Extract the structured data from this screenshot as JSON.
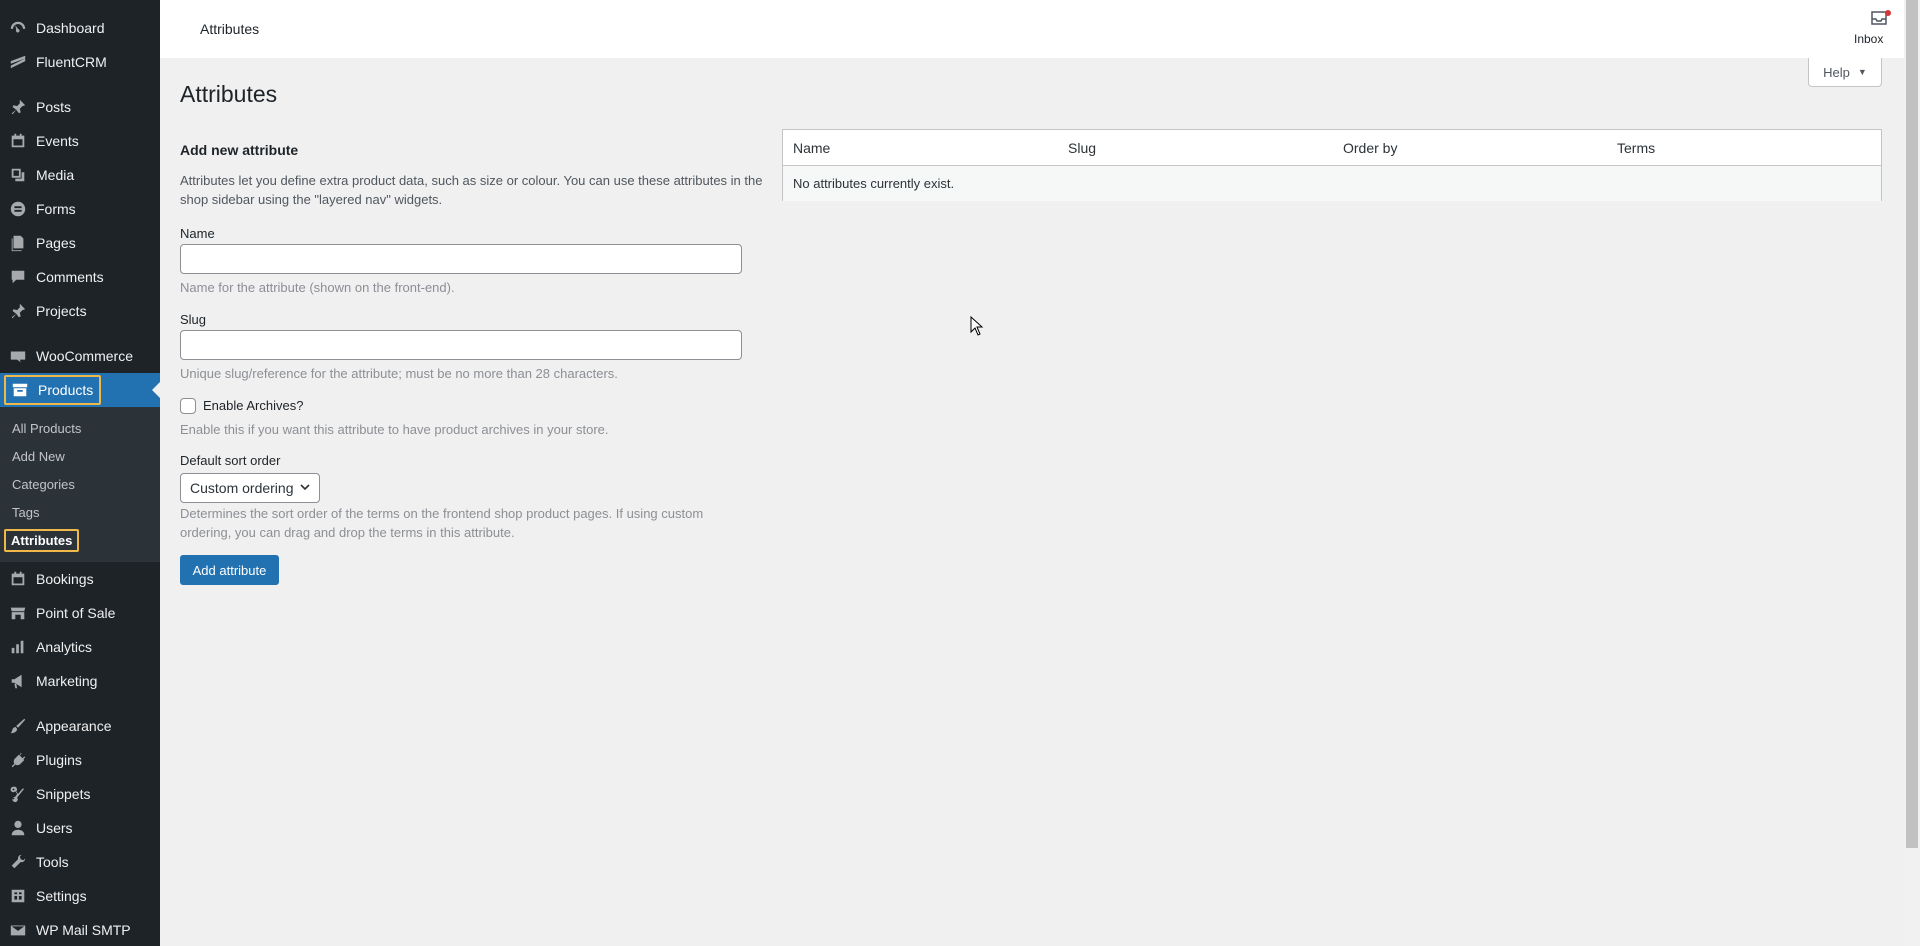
{
  "sidebar": {
    "items": [
      {
        "label": "Dashboard",
        "icon": "dashboard-icon"
      },
      {
        "label": "FluentCRM",
        "icon": "fluentcrm-icon"
      },
      {
        "label": "Posts",
        "icon": "pin-icon"
      },
      {
        "label": "Events",
        "icon": "calendar-icon"
      },
      {
        "label": "Media",
        "icon": "media-icon"
      },
      {
        "label": "Forms",
        "icon": "forms-icon"
      },
      {
        "label": "Pages",
        "icon": "pages-icon"
      },
      {
        "label": "Comments",
        "icon": "comment-icon"
      },
      {
        "label": "Projects",
        "icon": "pin-icon"
      },
      {
        "label": "WooCommerce",
        "icon": "woo-icon"
      },
      {
        "label": "Products",
        "icon": "archive-icon"
      },
      {
        "label": "Bookings",
        "icon": "calendar-icon"
      },
      {
        "label": "Point of Sale",
        "icon": "store-icon"
      },
      {
        "label": "Analytics",
        "icon": "chart-bar-icon"
      },
      {
        "label": "Marketing",
        "icon": "megaphone-icon"
      },
      {
        "label": "Appearance",
        "icon": "brush-icon"
      },
      {
        "label": "Plugins",
        "icon": "plug-icon"
      },
      {
        "label": "Snippets",
        "icon": "scissors-icon"
      },
      {
        "label": "Users",
        "icon": "user-icon"
      },
      {
        "label": "Tools",
        "icon": "wrench-icon"
      },
      {
        "label": "Settings",
        "icon": "settings-icon"
      },
      {
        "label": "WP Mail SMTP",
        "icon": "mail-icon"
      }
    ],
    "submenu": [
      "All Products",
      "Add New",
      "Categories",
      "Tags",
      "Attributes"
    ]
  },
  "header": {
    "breadcrumb": "Attributes",
    "inbox_label": "Inbox",
    "help_label": "Help"
  },
  "main": {
    "title": "Attributes",
    "form": {
      "title": "Add new attribute",
      "description": "Attributes let you define extra product data, such as size or colour. You can use these attributes in the shop sidebar using the \"layered nav\" widgets.",
      "name_label": "Name",
      "name_value": "",
      "name_hint": "Name for the attribute (shown on the front-end).",
      "slug_label": "Slug",
      "slug_value": "",
      "slug_hint": "Unique slug/reference for the attribute; must be no more than 28 characters.",
      "archives_label": "Enable Archives?",
      "archives_hint": "Enable this if you want this attribute to have product archives in your store.",
      "sort_label": "Default sort order",
      "sort_value": "Custom ordering",
      "sort_hint": "Determines the sort order of the terms on the frontend shop product pages. If using custom ordering, you can drag and drop the terms in this attribute.",
      "submit_label": "Add attribute"
    },
    "table": {
      "columns": [
        "Name",
        "Slug",
        "Order by",
        "Terms"
      ],
      "empty_message": "No attributes currently exist."
    }
  },
  "colors": {
    "sidebar_bg": "#1d2327",
    "accent": "#2271b1",
    "highlight": "#f0b849"
  }
}
